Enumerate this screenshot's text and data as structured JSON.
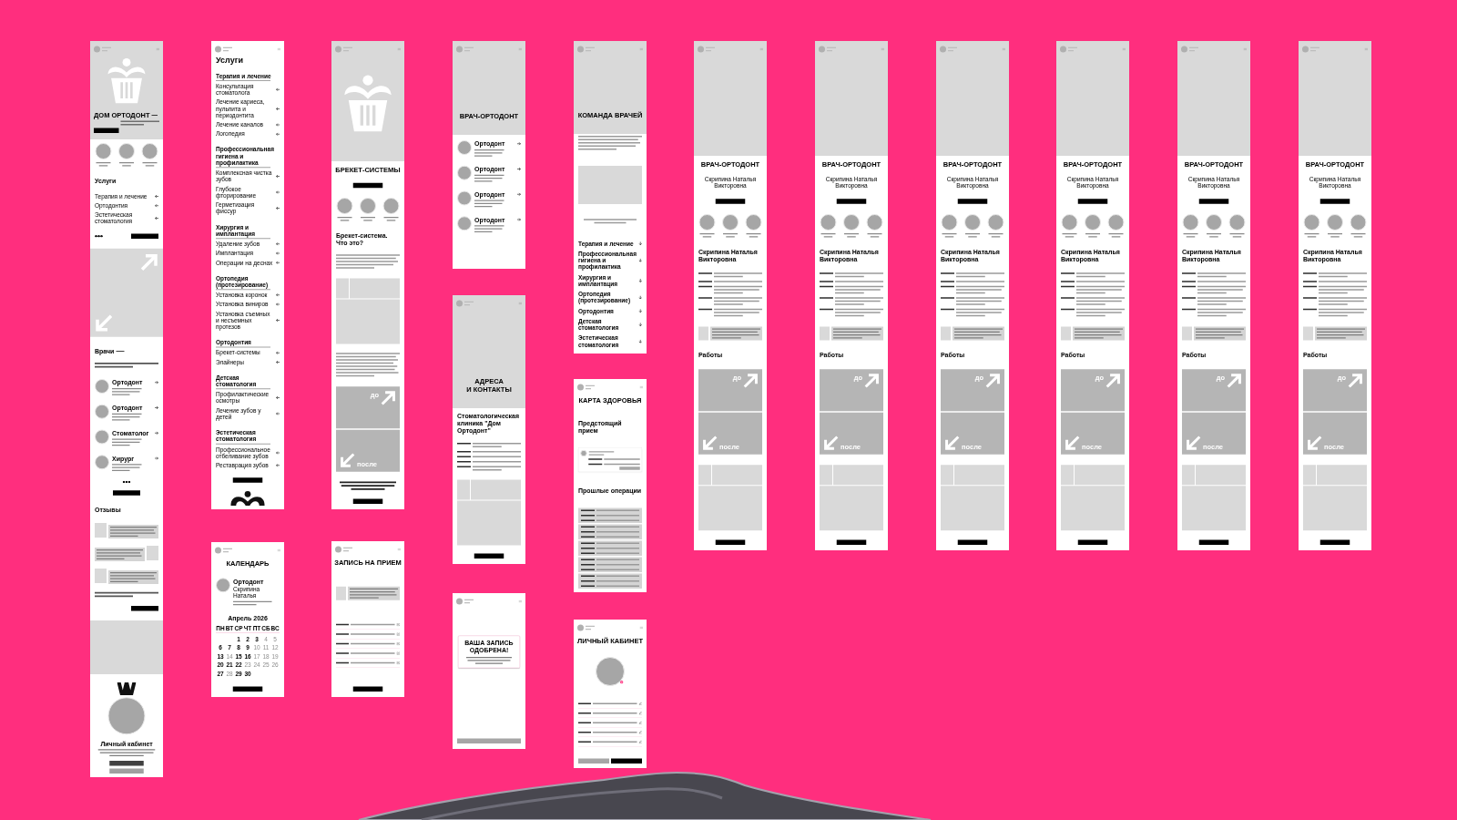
{
  "screens": [
    {
      "hero": {
        "kind": "brand",
        "title": "ДОМ ОРТОДОНТ",
        "rule": true
      },
      "blocks": [
        {
          "kind": "circles"
        },
        {
          "kind": "heading",
          "text": "Услуги"
        },
        {
          "kind": "links",
          "items": [
            "Терапия и лечение",
            "Ортодонтия",
            "Эстетическая стоматология"
          ]
        },
        {
          "kind": "more_row"
        },
        {
          "kind": "arrows_banner"
        },
        {
          "kind": "heading",
          "text": "Врачи",
          "rule": true
        },
        {
          "kind": "lines"
        },
        {
          "kind": "doctors",
          "items": [
            {
              "role": "Ортодонт"
            },
            {
              "role": "Ортодонт"
            },
            {
              "role": "Стоматолог"
            },
            {
              "role": "Хирург"
            }
          ]
        },
        {
          "kind": "more_stack"
        },
        {
          "kind": "heading",
          "text": "Отзывы"
        },
        {
          "kind": "reviews",
          "items": [
            {
              "kind": "photo_left"
            },
            {
              "kind": "photo_right"
            },
            {
              "kind": "photo_left"
            }
          ]
        },
        {
          "kind": "lines"
        },
        {
          "kind": "button_end"
        },
        {
          "kind": "banner"
        },
        {
          "kind": "cabinet_promo",
          "title": "Личный кабинет",
          "buttons": [
            {
              "kind": "dark"
            },
            {
              "kind": "light"
            }
          ]
        }
      ]
    },
    {
      "blocks": [
        {
          "kind": "page_heading",
          "text": "Услуги"
        },
        {
          "kind": "service_group",
          "title": "Терапия и лечение",
          "items": [
            "Консультация стоматолога",
            "Лечение кариеса, пульпита и периодонтита",
            "Лечение каналов",
            "Логопедия"
          ]
        },
        {
          "kind": "service_group",
          "title": "Профессиональная гигиена и профилактика",
          "items": [
            "Комплексная чистка зубов",
            "Глубокое фторирование",
            "Герметизация фиссур"
          ]
        },
        {
          "kind": "service_group",
          "title": "Хирургия и имплантация",
          "items": [
            "Удаление зубов",
            "Имплантация",
            "Операции на деснах"
          ]
        },
        {
          "kind": "service_group",
          "title": "Ортопедия (протезирование)",
          "items": [
            "Установка коронок",
            "Установка виниров",
            "Установка съемных и несъемных протезов"
          ]
        },
        {
          "kind": "service_group",
          "title": "Ортодонтия",
          "items": [
            "Брекет-системы",
            "Элайнеры"
          ]
        },
        {
          "kind": "service_group",
          "title": "Детская стоматология",
          "items": [
            "Профилактические осмотры",
            "Лечение зубов у детей"
          ]
        },
        {
          "kind": "service_group",
          "title": "Эстетическая стоматология",
          "items": [
            "Профессиональное отбеливание зубов",
            "Реставрация зубов"
          ]
        },
        {
          "kind": "button"
        },
        {
          "kind": "logo_mark"
        }
      ]
    },
    {
      "blocks": [
        {
          "kind": "title",
          "text": "КАЛЕНДАРЬ"
        },
        {
          "kind": "doctor_card",
          "role": "Ортодонт",
          "name": "Скрипина Наталья"
        },
        {
          "kind": "calendar",
          "month": "Апрель 2026",
          "weekdays": [
            "ПН",
            "ВТ",
            "СР",
            "ЧТ",
            "ПТ",
            "СБ",
            "ВС"
          ],
          "days": [
            {
              "label": "1",
              "available": true
            },
            {
              "label": "2",
              "available": true
            },
            {
              "label": "3",
              "available": true
            },
            {
              "label": "4",
              "available": false
            },
            {
              "label": "5",
              "available": false
            },
            {
              "label": "6",
              "available": true
            },
            {
              "label": "7",
              "available": true
            },
            {
              "label": "8",
              "available": true
            },
            {
              "label": "9",
              "available": true
            },
            {
              "label": "10",
              "available": false
            },
            {
              "label": "11",
              "available": false
            },
            {
              "label": "12",
              "available": false
            },
            {
              "label": "13",
              "available": true
            },
            {
              "label": "14",
              "available": false
            },
            {
              "label": "15",
              "available": true
            },
            {
              "label": "16",
              "available": true
            },
            {
              "label": "17",
              "available": false
            },
            {
              "label": "18",
              "available": false
            },
            {
              "label": "19",
              "available": false
            },
            {
              "label": "20",
              "available": true
            },
            {
              "label": "21",
              "available": true
            },
            {
              "label": "22",
              "available": true
            },
            {
              "label": "23",
              "available": false
            },
            {
              "label": "24",
              "available": false
            },
            {
              "label": "25",
              "available": false
            },
            {
              "label": "26",
              "available": false
            },
            {
              "label": "27",
              "available": true
            },
            {
              "label": "28",
              "available": false
            },
            {
              "label": "29",
              "available": true
            },
            {
              "label": "30",
              "available": true
            }
          ]
        },
        {
          "kind": "button_bottom"
        }
      ]
    },
    {
      "hero": {
        "kind": "logo"
      },
      "blocks": [
        {
          "kind": "title",
          "text": "БРЕКЕТ-СИСТЕМЫ"
        },
        {
          "kind": "button"
        },
        {
          "kind": "circles"
        },
        {
          "kind": "heading",
          "text": "Брекет-система. Что это?"
        },
        {
          "kind": "paragraph"
        },
        {
          "kind": "gallery"
        },
        {
          "kind": "long_paragraph"
        },
        {
          "kind": "before_after",
          "before": "до",
          "after": "после"
        },
        {
          "kind": "notice"
        },
        {
          "kind": "button_bottom"
        }
      ]
    },
    {
      "blocks": [
        {
          "kind": "title",
          "text": "ЗАПИСЬ НА ПРИЕМ"
        },
        {
          "kind": "note"
        },
        {
          "kind": "form_rows"
        },
        {
          "kind": "button_bottom"
        }
      ]
    },
    {
      "hero": {
        "kind": "title",
        "title_lines": [
          "ВРАЧ-ОРТОДОНТ"
        ]
      },
      "blocks": [
        {
          "kind": "doctors",
          "items": [
            {
              "role": "Ортодонт"
            },
            {
              "role": "Ортодонт"
            },
            {
              "role": "Ортодонт"
            },
            {
              "role": "Ортодонт"
            }
          ]
        }
      ]
    },
    {
      "hero": {
        "kind": "title",
        "title_lines": [
          "АДРЕСА",
          "И КОНТАКТЫ"
        ]
      },
      "blocks": [
        {
          "kind": "heading",
          "text": "Стоматологическая клиника \"Дом Ортодонт\""
        },
        {
          "kind": "contact_rows"
        },
        {
          "kind": "gallery"
        },
        {
          "kind": "button_bottom"
        }
      ]
    },
    {
      "blocks": [
        {
          "kind": "approval_card",
          "title": "ВАША ЗАПИСЬ ОДОБРЕНА!"
        },
        {
          "kind": "button_muted"
        }
      ]
    },
    {
      "hero": {
        "kind": "title",
        "title_lines": [
          "КОМАНДА ВРАЧЕЙ"
        ]
      },
      "blocks": [
        {
          "kind": "paragraph"
        },
        {
          "kind": "photo"
        },
        {
          "kind": "caption"
        },
        {
          "kind": "accordion",
          "items": [
            {
              "label": "Терапия и лечение",
              "expanded": false
            },
            {
              "label": "Профессиональная гигиена и профилактика",
              "expanded": false
            },
            {
              "label": "Хирургия и имплантация",
              "expanded": false
            },
            {
              "label": "Ортопедия (протезирование)",
              "expanded": false
            },
            {
              "label": "Ортодонтия",
              "expanded": false
            },
            {
              "label": "Детская стоматология",
              "expanded": false
            },
            {
              "label": "Эстетическая стоматология",
              "expanded": false
            }
          ]
        }
      ]
    },
    {
      "blocks": [
        {
          "kind": "title",
          "text": "КАРТА ЗДОРОВЬЯ"
        },
        {
          "kind": "heading",
          "text": "Предстоящий прием"
        },
        {
          "kind": "appointment_card"
        },
        {
          "kind": "heading",
          "text": "Прошлые операции"
        },
        {
          "kind": "history"
        }
      ]
    },
    {
      "blocks": [
        {
          "kind": "title",
          "text": "ЛИЧНЫЙ КАБИНЕТ"
        },
        {
          "kind": "avatar"
        },
        {
          "kind": "profile_rows"
        },
        {
          "kind": "button_pair",
          "buttons": [
            {
              "kind": "muted"
            },
            {
              "kind": "black"
            }
          ]
        }
      ]
    },
    {
      "hero": {
        "kind": "plain"
      },
      "blocks": [
        {
          "kind": "title",
          "text": "ВРАЧ-ОРТОДОНТ"
        },
        {
          "kind": "subtitle",
          "text": "Скрипина Наталья Викторовна"
        },
        {
          "kind": "button"
        },
        {
          "kind": "circles"
        },
        {
          "kind": "name_heading",
          "text": "Скрипина Наталья Викторовна"
        },
        {
          "kind": "info_rows"
        },
        {
          "kind": "note"
        },
        {
          "kind": "heading",
          "text": "Работы"
        },
        {
          "kind": "before_after",
          "before": "до",
          "after": "после"
        },
        {
          "kind": "gallery"
        },
        {
          "kind": "button_bottom"
        }
      ]
    },
    {
      "hero": {
        "kind": "plain"
      },
      "blocks": [
        {
          "kind": "title",
          "text": "ВРАЧ-ОРТОДОНТ"
        },
        {
          "kind": "subtitle",
          "text": "Скрипина Наталья Викторовна"
        },
        {
          "kind": "button"
        },
        {
          "kind": "circles"
        },
        {
          "kind": "name_heading",
          "text": "Скрипина Наталья Викторовна"
        },
        {
          "kind": "info_rows"
        },
        {
          "kind": "note"
        },
        {
          "kind": "heading",
          "text": "Работы"
        },
        {
          "kind": "before_after",
          "before": "до",
          "after": "после"
        },
        {
          "kind": "gallery"
        },
        {
          "kind": "button_bottom"
        }
      ]
    },
    {
      "hero": {
        "kind": "plain"
      },
      "blocks": [
        {
          "kind": "title",
          "text": "ВРАЧ-ОРТОДОНТ"
        },
        {
          "kind": "subtitle",
          "text": "Скрипина Наталья Викторовна"
        },
        {
          "kind": "button"
        },
        {
          "kind": "circles"
        },
        {
          "kind": "name_heading",
          "text": "Скрипина Наталья Викторовна"
        },
        {
          "kind": "info_rows"
        },
        {
          "kind": "note"
        },
        {
          "kind": "heading",
          "text": "Работы"
        },
        {
          "kind": "before_after",
          "before": "до",
          "after": "после"
        },
        {
          "kind": "gallery"
        },
        {
          "kind": "button_bottom"
        }
      ]
    },
    {
      "hero": {
        "kind": "plain"
      },
      "blocks": [
        {
          "kind": "title",
          "text": "ВРАЧ-ОРТОДОНТ"
        },
        {
          "kind": "subtitle",
          "text": "Скрипина Наталья Викторовна"
        },
        {
          "kind": "button"
        },
        {
          "kind": "circles"
        },
        {
          "kind": "name_heading",
          "text": "Скрипина Наталья Викторовна"
        },
        {
          "kind": "info_rows"
        },
        {
          "kind": "note"
        },
        {
          "kind": "heading",
          "text": "Работы"
        },
        {
          "kind": "before_after",
          "before": "до",
          "after": "после"
        },
        {
          "kind": "gallery"
        },
        {
          "kind": "button_bottom"
        }
      ]
    },
    {
      "hero": {
        "kind": "plain"
      },
      "blocks": [
        {
          "kind": "title",
          "text": "ВРАЧ-ОРТОДОНТ"
        },
        {
          "kind": "subtitle",
          "text": "Скрипина Наталья Викторовна"
        },
        {
          "kind": "button"
        },
        {
          "kind": "circles"
        },
        {
          "kind": "name_heading",
          "text": "Скрипина Наталья Викторовна"
        },
        {
          "kind": "info_rows"
        },
        {
          "kind": "note"
        },
        {
          "kind": "heading",
          "text": "Работы"
        },
        {
          "kind": "before_after",
          "before": "до",
          "after": "после"
        },
        {
          "kind": "gallery"
        },
        {
          "kind": "button_bottom"
        }
      ]
    },
    {
      "hero": {
        "kind": "plain"
      },
      "blocks": [
        {
          "kind": "title",
          "text": "ВРАЧ-ОРТОДОНТ"
        },
        {
          "kind": "subtitle",
          "text": "Скрипина Наталья Викторовна"
        },
        {
          "kind": "button"
        },
        {
          "kind": "circles"
        },
        {
          "kind": "name_heading",
          "text": "Скрипина Наталья Викторовна"
        },
        {
          "kind": "info_rows"
        },
        {
          "kind": "note"
        },
        {
          "kind": "heading",
          "text": "Работы"
        },
        {
          "kind": "before_after",
          "before": "до",
          "after": "после"
        },
        {
          "kind": "gallery"
        },
        {
          "kind": "button_bottom"
        }
      ]
    }
  ]
}
